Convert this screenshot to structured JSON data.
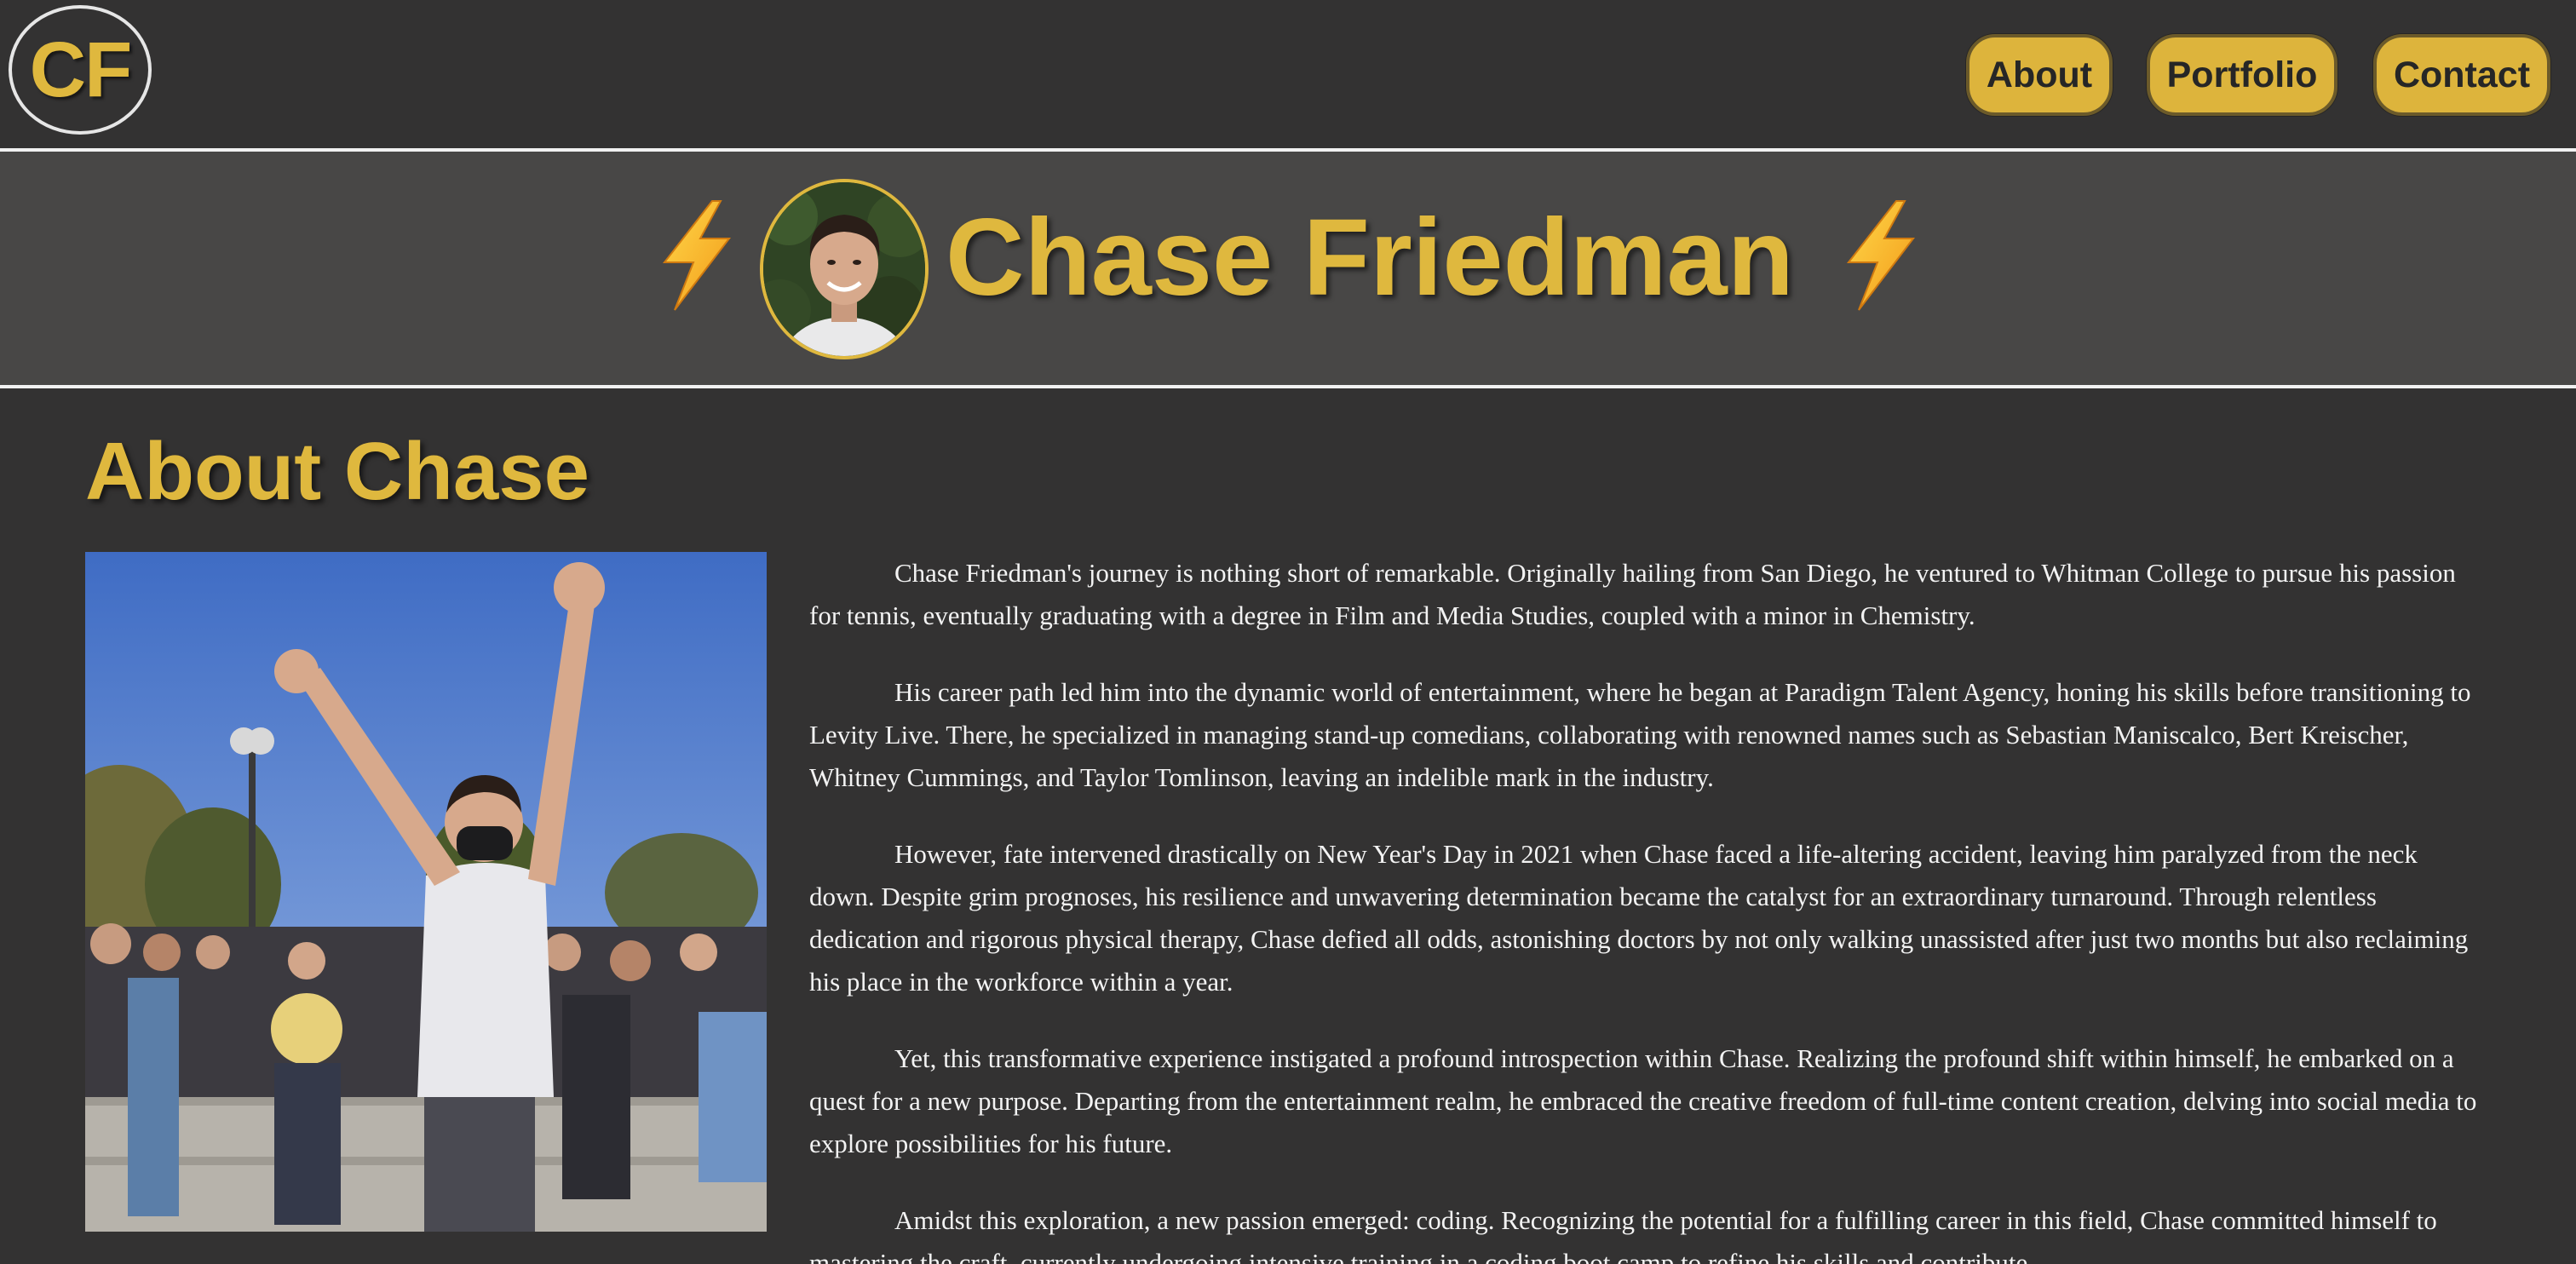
{
  "header": {
    "logo_text": "CF",
    "nav": [
      {
        "label": "About"
      },
      {
        "label": "Portfolio"
      },
      {
        "label": "Contact"
      }
    ]
  },
  "hero": {
    "name": "Chase Friedman",
    "left_icon": "lightning-bolt-icon",
    "right_icon": "lightning-bolt-icon",
    "avatar": "profile-photo"
  },
  "about": {
    "title": "About Chase",
    "photo": "celebration-photo",
    "paragraphs": [
      "Chase Friedman's journey is nothing short of remarkable. Originally hailing from San Diego, he ventured to Whitman College to pursue his passion for tennis, eventually graduating with a degree in Film and Media Studies, coupled with a minor in Chemistry.",
      "His career path led him into the dynamic world of entertainment, where he began at Paradigm Talent Agency, honing his skills before transitioning to Levity Live. There, he specialized in managing stand-up comedians, collaborating with renowned names such as Sebastian Maniscalco, Bert Kreischer, Whitney Cummings, and Taylor Tomlinson, leaving an indelible mark in the industry.",
      "However, fate intervened drastically on New Year's Day in 2021 when Chase faced a life-altering accident, leaving him paralyzed from the neck down. Despite grim prognoses, his resilience and unwavering determination became the catalyst for an extraordinary turnaround. Through relentless dedication and rigorous physical therapy, Chase defied all odds, astonishing doctors by not only walking unassisted after just two months but also reclaiming his place in the workforce within a year.",
      "Yet, this transformative experience instigated a profound introspection within Chase. Realizing the profound shift within himself, he embarked on a quest for a new purpose. Departing from the entertainment realm, he embraced the creative freedom of full-time content creation, delving into social media to explore possibilities for his future.",
      "Amidst this exploration, a new passion emerged: coding. Recognizing the potential for a fulfilling career in this field, Chase committed himself to mastering the craft, currently undergoing intensive training in a coding boot camp to refine his skills and contribute"
    ]
  },
  "colors": {
    "background": "#333232",
    "hero_band": "#484746",
    "accent_gold": "#dfb83e",
    "button_text": "#262626",
    "body_text": "#f3f3f3",
    "divider": "#f1f1f1"
  }
}
